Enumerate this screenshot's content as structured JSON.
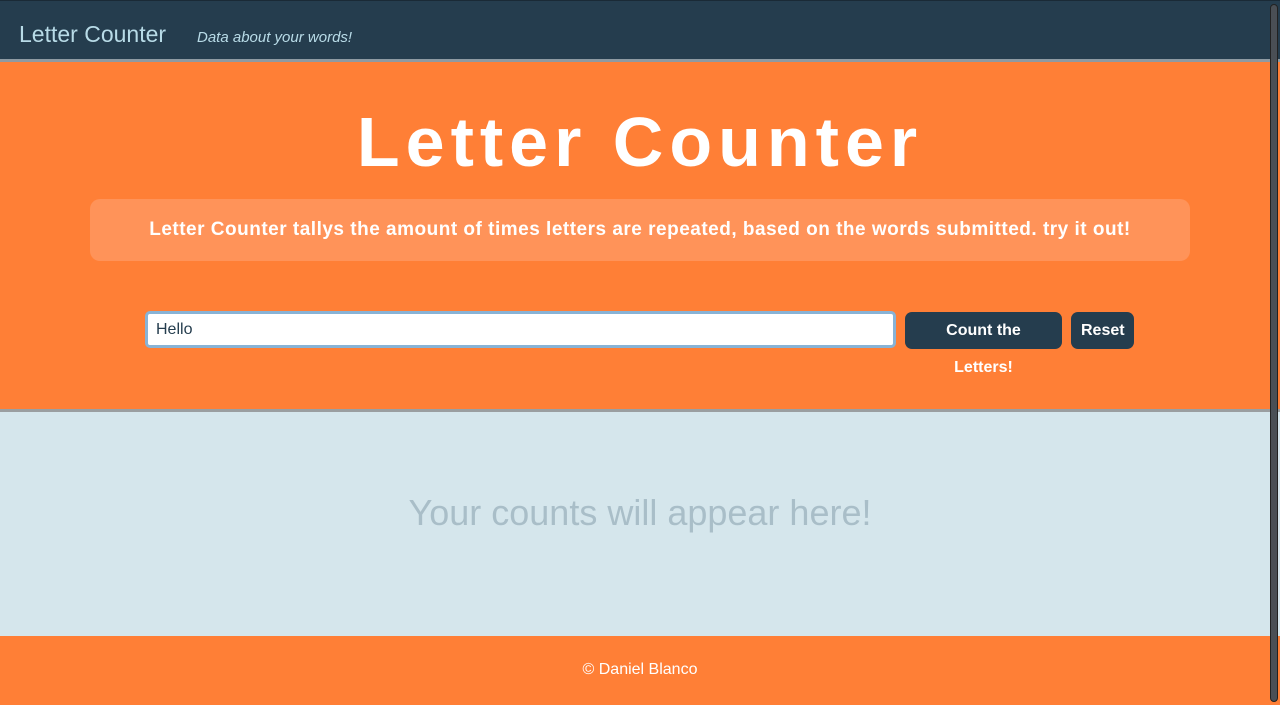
{
  "navbar": {
    "brand": "Letter Counter",
    "tagline": "Data about your words!"
  },
  "hero": {
    "title": "Letter Counter",
    "description": "Letter Counter tallys the amount of times letters are repeated, based on the words submitted. try it out!"
  },
  "form": {
    "input_value": "Hello",
    "count_button_label": "Count the Letters!",
    "reset_button_label": "Reset"
  },
  "results": {
    "placeholder_message": "Your counts will appear here!"
  },
  "footer": {
    "copyright": "© Daniel Blanco"
  },
  "colors": {
    "nav_bg": "#253d4e",
    "accent_orange": "#ff7f36",
    "results_bg": "#d5e6ec",
    "button_bg": "#253d4e"
  }
}
